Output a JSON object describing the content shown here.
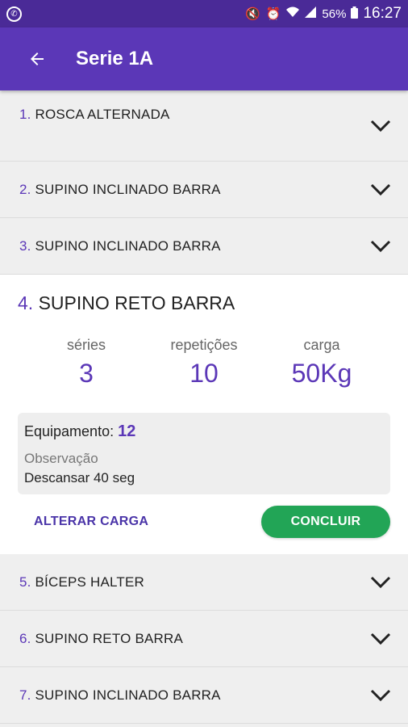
{
  "status_bar": {
    "battery": "56%",
    "time": "16:27",
    "icons": [
      "whatsapp-icon",
      "mute-icon",
      "alarm-icon",
      "wifi-icon",
      "signal-icon",
      "battery-icon"
    ]
  },
  "app_bar": {
    "title": "Serie 1A",
    "back_icon": "arrow-back-icon"
  },
  "exercises": [
    {
      "num": "1.",
      "name": "ROSCA ALTERNADA"
    },
    {
      "num": "2.",
      "name": "SUPINO INCLINADO BARRA"
    },
    {
      "num": "3.",
      "name": "SUPINO INCLINADO BARRA"
    },
    {
      "num": "5.",
      "name": "BÍCEPS HALTER"
    },
    {
      "num": "6.",
      "name": "SUPINO RETO BARRA"
    },
    {
      "num": "7.",
      "name": "SUPINO INCLINADO BARRA"
    }
  ],
  "expanded": {
    "num": "4.",
    "name": "SUPINO RETO BARRA",
    "stats": [
      {
        "label": "séries",
        "value": "3"
      },
      {
        "label": "repetições",
        "value": "10"
      },
      {
        "label": "carga",
        "value": "50Kg"
      }
    ],
    "equipment_label": "Equipamento:",
    "equipment_value": "12",
    "obs_label": "Observação",
    "obs_text": "Descansar 40 seg",
    "alter_button": "ALTERAR CARGA",
    "conclude_button": "CONCLUIR"
  },
  "colors": {
    "primary": "#5b37b7",
    "status_bar": "#4a2a97",
    "success": "#22a556"
  }
}
